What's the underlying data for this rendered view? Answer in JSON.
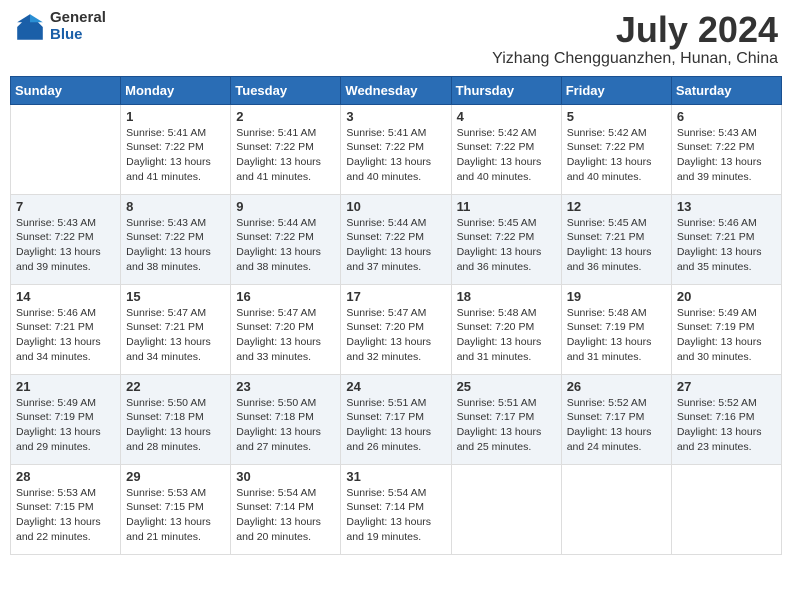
{
  "header": {
    "logo_general": "General",
    "logo_blue": "Blue",
    "month_title": "July 2024",
    "location": "Yizhang Chengguanzhen, Hunan, China"
  },
  "days_of_week": [
    "Sunday",
    "Monday",
    "Tuesday",
    "Wednesday",
    "Thursday",
    "Friday",
    "Saturday"
  ],
  "weeks": [
    [
      {
        "day": "",
        "info": ""
      },
      {
        "day": "1",
        "info": "Sunrise: 5:41 AM\nSunset: 7:22 PM\nDaylight: 13 hours and 41 minutes."
      },
      {
        "day": "2",
        "info": "Sunrise: 5:41 AM\nSunset: 7:22 PM\nDaylight: 13 hours and 41 minutes."
      },
      {
        "day": "3",
        "info": "Sunrise: 5:41 AM\nSunset: 7:22 PM\nDaylight: 13 hours and 40 minutes."
      },
      {
        "day": "4",
        "info": "Sunrise: 5:42 AM\nSunset: 7:22 PM\nDaylight: 13 hours and 40 minutes."
      },
      {
        "day": "5",
        "info": "Sunrise: 5:42 AM\nSunset: 7:22 PM\nDaylight: 13 hours and 40 minutes."
      },
      {
        "day": "6",
        "info": "Sunrise: 5:43 AM\nSunset: 7:22 PM\nDaylight: 13 hours and 39 minutes."
      }
    ],
    [
      {
        "day": "7",
        "info": "Sunrise: 5:43 AM\nSunset: 7:22 PM\nDaylight: 13 hours and 39 minutes."
      },
      {
        "day": "8",
        "info": "Sunrise: 5:43 AM\nSunset: 7:22 PM\nDaylight: 13 hours and 38 minutes."
      },
      {
        "day": "9",
        "info": "Sunrise: 5:44 AM\nSunset: 7:22 PM\nDaylight: 13 hours and 38 minutes."
      },
      {
        "day": "10",
        "info": "Sunrise: 5:44 AM\nSunset: 7:22 PM\nDaylight: 13 hours and 37 minutes."
      },
      {
        "day": "11",
        "info": "Sunrise: 5:45 AM\nSunset: 7:22 PM\nDaylight: 13 hours and 36 minutes."
      },
      {
        "day": "12",
        "info": "Sunrise: 5:45 AM\nSunset: 7:21 PM\nDaylight: 13 hours and 36 minutes."
      },
      {
        "day": "13",
        "info": "Sunrise: 5:46 AM\nSunset: 7:21 PM\nDaylight: 13 hours and 35 minutes."
      }
    ],
    [
      {
        "day": "14",
        "info": "Sunrise: 5:46 AM\nSunset: 7:21 PM\nDaylight: 13 hours and 34 minutes."
      },
      {
        "day": "15",
        "info": "Sunrise: 5:47 AM\nSunset: 7:21 PM\nDaylight: 13 hours and 34 minutes."
      },
      {
        "day": "16",
        "info": "Sunrise: 5:47 AM\nSunset: 7:20 PM\nDaylight: 13 hours and 33 minutes."
      },
      {
        "day": "17",
        "info": "Sunrise: 5:47 AM\nSunset: 7:20 PM\nDaylight: 13 hours and 32 minutes."
      },
      {
        "day": "18",
        "info": "Sunrise: 5:48 AM\nSunset: 7:20 PM\nDaylight: 13 hours and 31 minutes."
      },
      {
        "day": "19",
        "info": "Sunrise: 5:48 AM\nSunset: 7:19 PM\nDaylight: 13 hours and 31 minutes."
      },
      {
        "day": "20",
        "info": "Sunrise: 5:49 AM\nSunset: 7:19 PM\nDaylight: 13 hours and 30 minutes."
      }
    ],
    [
      {
        "day": "21",
        "info": "Sunrise: 5:49 AM\nSunset: 7:19 PM\nDaylight: 13 hours and 29 minutes."
      },
      {
        "day": "22",
        "info": "Sunrise: 5:50 AM\nSunset: 7:18 PM\nDaylight: 13 hours and 28 minutes."
      },
      {
        "day": "23",
        "info": "Sunrise: 5:50 AM\nSunset: 7:18 PM\nDaylight: 13 hours and 27 minutes."
      },
      {
        "day": "24",
        "info": "Sunrise: 5:51 AM\nSunset: 7:17 PM\nDaylight: 13 hours and 26 minutes."
      },
      {
        "day": "25",
        "info": "Sunrise: 5:51 AM\nSunset: 7:17 PM\nDaylight: 13 hours and 25 minutes."
      },
      {
        "day": "26",
        "info": "Sunrise: 5:52 AM\nSunset: 7:17 PM\nDaylight: 13 hours and 24 minutes."
      },
      {
        "day": "27",
        "info": "Sunrise: 5:52 AM\nSunset: 7:16 PM\nDaylight: 13 hours and 23 minutes."
      }
    ],
    [
      {
        "day": "28",
        "info": "Sunrise: 5:53 AM\nSunset: 7:15 PM\nDaylight: 13 hours and 22 minutes."
      },
      {
        "day": "29",
        "info": "Sunrise: 5:53 AM\nSunset: 7:15 PM\nDaylight: 13 hours and 21 minutes."
      },
      {
        "day": "30",
        "info": "Sunrise: 5:54 AM\nSunset: 7:14 PM\nDaylight: 13 hours and 20 minutes."
      },
      {
        "day": "31",
        "info": "Sunrise: 5:54 AM\nSunset: 7:14 PM\nDaylight: 13 hours and 19 minutes."
      },
      {
        "day": "",
        "info": ""
      },
      {
        "day": "",
        "info": ""
      },
      {
        "day": "",
        "info": ""
      }
    ]
  ]
}
